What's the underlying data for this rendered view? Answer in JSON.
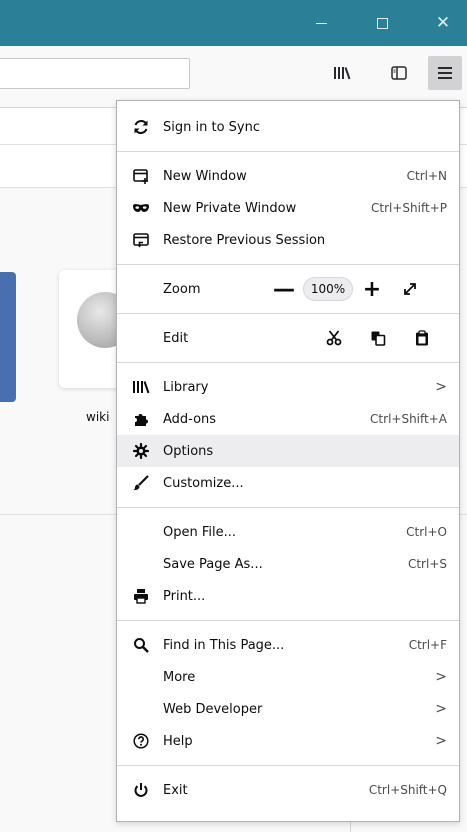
{
  "window": {
    "minimize_icon": "minimize-icon",
    "maximize_icon": "maximize-icon",
    "close_icon": "close-icon",
    "close_glyph": "✕",
    "accent": "#2b7f97"
  },
  "toolbar": {
    "url_value": "",
    "library_icon": "library-icon",
    "sidebar_icon": "sidebar-icon",
    "menu_icon": "hamburger-menu-icon"
  },
  "content": {
    "wiki_label": "wiki"
  },
  "menu": {
    "sync": {
      "label": "Sign in to Sync",
      "icon": "sync-icon"
    },
    "new_window": {
      "label": "New Window",
      "shortcut": "Ctrl+N",
      "icon": "new-window-icon"
    },
    "new_private": {
      "label": "New Private Window",
      "shortcut": "Ctrl+Shift+P",
      "icon": "private-mask-icon"
    },
    "restore": {
      "label": "Restore Previous Session",
      "icon": "restore-session-icon"
    },
    "zoom": {
      "label": "Zoom",
      "minus": "—",
      "value": "100%",
      "plus": "+",
      "fullscreen": "⤢"
    },
    "edit": {
      "label": "Edit",
      "cut_icon": "cut-icon",
      "copy_icon": "copy-icon",
      "paste_icon": "paste-icon"
    },
    "library": {
      "label": "Library",
      "arrow": ">",
      "icon": "library-icon"
    },
    "addons": {
      "label": "Add-ons",
      "shortcut": "Ctrl+Shift+A",
      "icon": "puzzle-icon"
    },
    "options": {
      "label": "Options",
      "icon": "gear-icon"
    },
    "customize": {
      "label": "Customize...",
      "icon": "paintbrush-icon"
    },
    "open_file": {
      "label": "Open File...",
      "shortcut": "Ctrl+O"
    },
    "save_page": {
      "label": "Save Page As...",
      "shortcut": "Ctrl+S"
    },
    "print": {
      "label": "Print...",
      "icon": "printer-icon"
    },
    "find": {
      "label": "Find in This Page...",
      "shortcut": "Ctrl+F",
      "icon": "search-icon"
    },
    "more": {
      "label": "More",
      "arrow": ">"
    },
    "web_dev": {
      "label": "Web Developer",
      "arrow": ">"
    },
    "help": {
      "label": "Help",
      "arrow": ">",
      "icon": "help-icon"
    },
    "exit": {
      "label": "Exit",
      "shortcut": "Ctrl+Shift+Q",
      "icon": "power-icon"
    }
  }
}
